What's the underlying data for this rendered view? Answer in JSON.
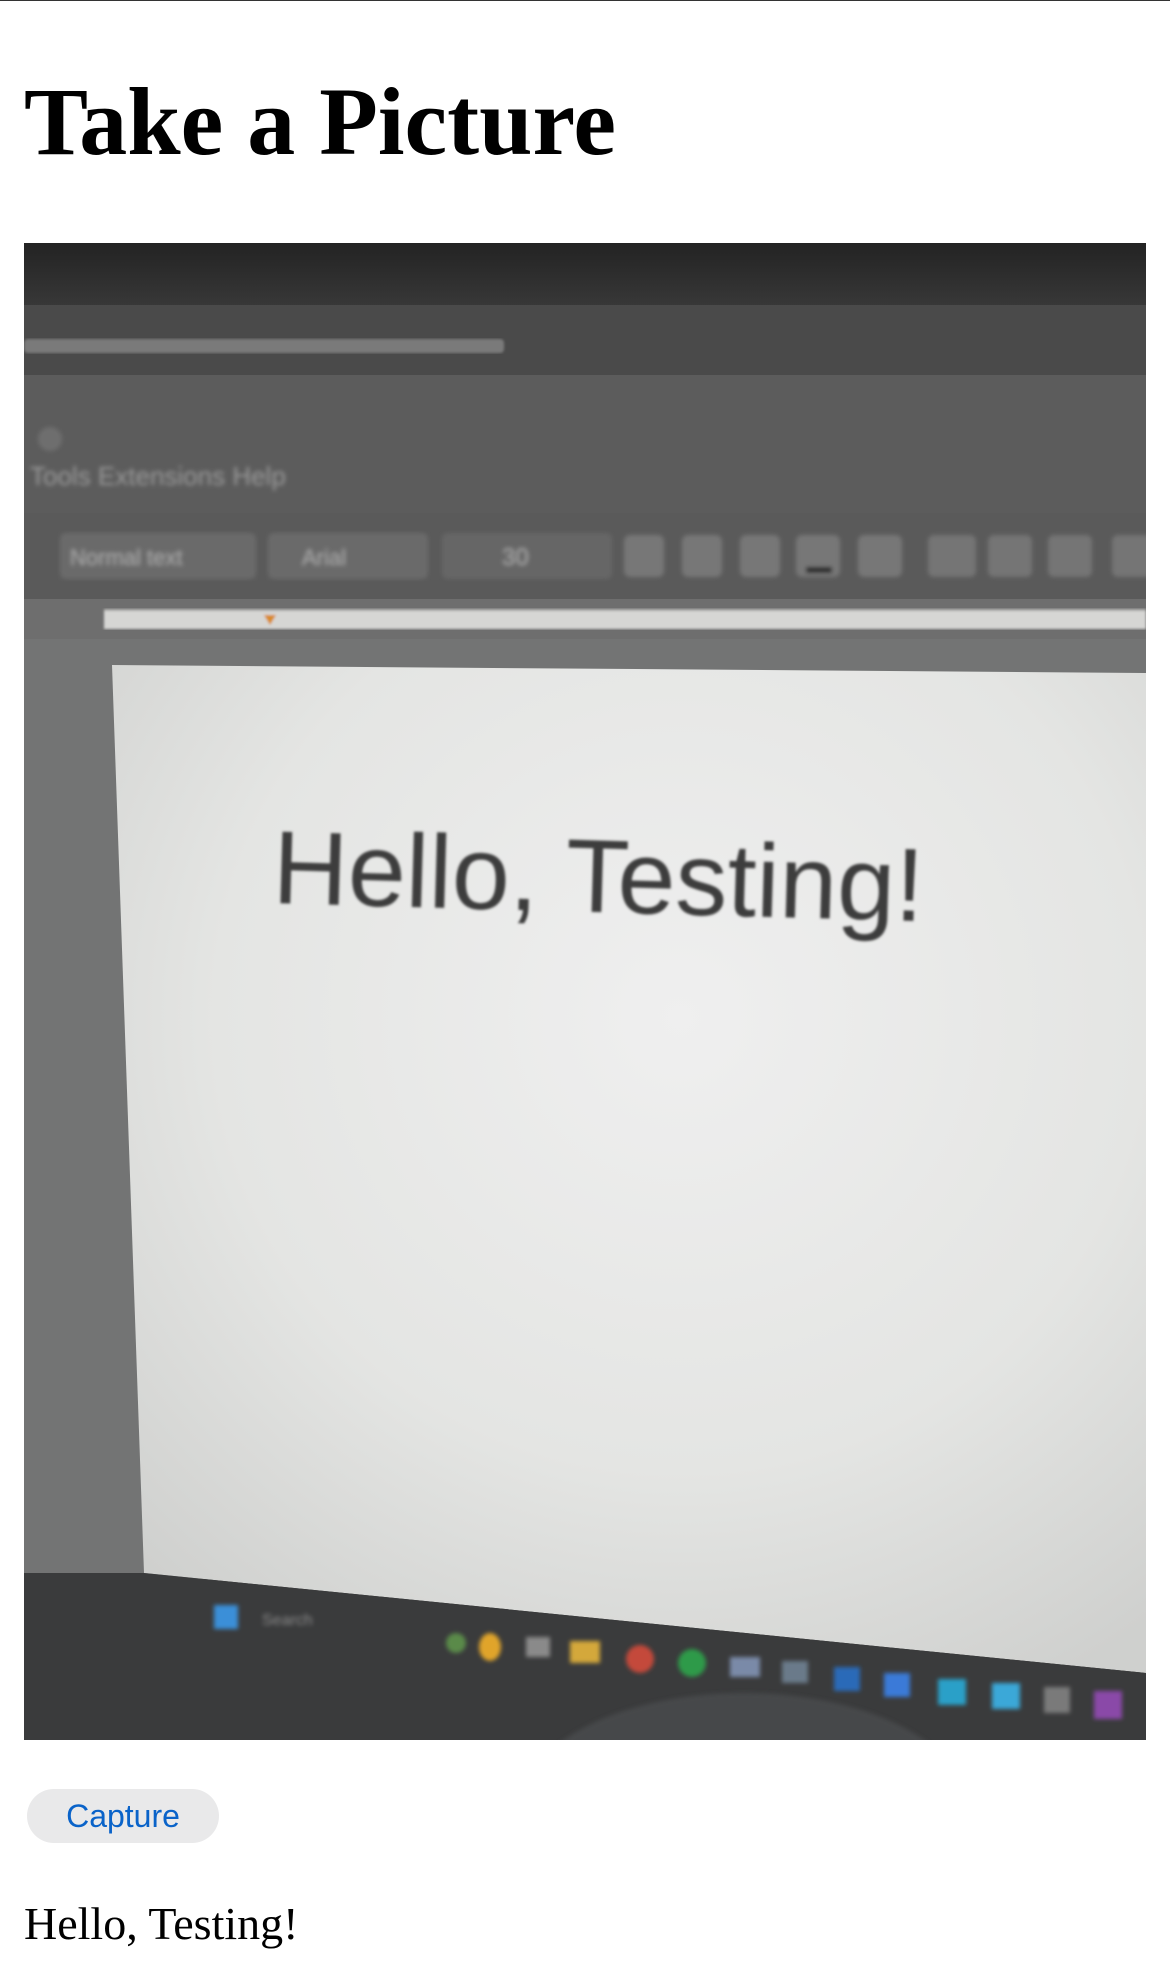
{
  "page": {
    "title": "Take a Picture"
  },
  "camera_preview": {
    "doc_text": "Hello, Testing!",
    "menu_text": "Tools  Extensions  Help",
    "style_dropdown": "Normal text",
    "font_dropdown": "Arial",
    "font_size": "30",
    "taskbar_search": "Search"
  },
  "capture": {
    "label": "Capture"
  },
  "result": {
    "text": "Hello, Testing!"
  },
  "colors": {
    "button_text": "#0a63c9",
    "button_bg": "#e9e9ea"
  }
}
